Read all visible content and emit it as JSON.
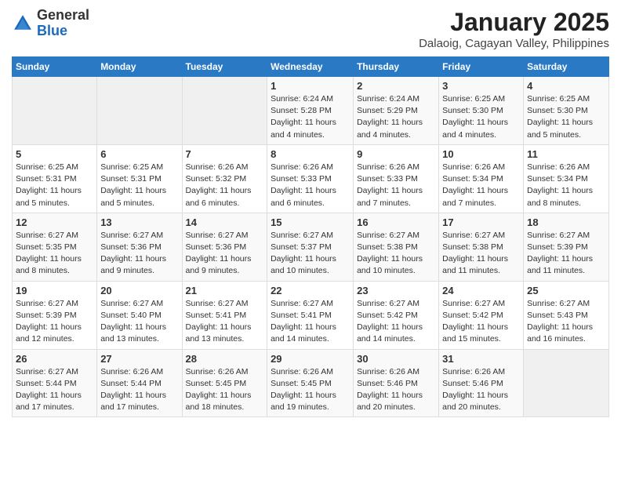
{
  "logo": {
    "general": "General",
    "blue": "Blue"
  },
  "title": "January 2025",
  "subtitle": "Dalaoig, Cagayan Valley, Philippines",
  "weekdays": [
    "Sunday",
    "Monday",
    "Tuesday",
    "Wednesday",
    "Thursday",
    "Friday",
    "Saturday"
  ],
  "weeks": [
    [
      {
        "day": "",
        "info": ""
      },
      {
        "day": "",
        "info": ""
      },
      {
        "day": "",
        "info": ""
      },
      {
        "day": "1",
        "info": "Sunrise: 6:24 AM\nSunset: 5:28 PM\nDaylight: 11 hours and 4 minutes."
      },
      {
        "day": "2",
        "info": "Sunrise: 6:24 AM\nSunset: 5:29 PM\nDaylight: 11 hours and 4 minutes."
      },
      {
        "day": "3",
        "info": "Sunrise: 6:25 AM\nSunset: 5:30 PM\nDaylight: 11 hours and 4 minutes."
      },
      {
        "day": "4",
        "info": "Sunrise: 6:25 AM\nSunset: 5:30 PM\nDaylight: 11 hours and 5 minutes."
      }
    ],
    [
      {
        "day": "5",
        "info": "Sunrise: 6:25 AM\nSunset: 5:31 PM\nDaylight: 11 hours and 5 minutes."
      },
      {
        "day": "6",
        "info": "Sunrise: 6:25 AM\nSunset: 5:31 PM\nDaylight: 11 hours and 5 minutes."
      },
      {
        "day": "7",
        "info": "Sunrise: 6:26 AM\nSunset: 5:32 PM\nDaylight: 11 hours and 6 minutes."
      },
      {
        "day": "8",
        "info": "Sunrise: 6:26 AM\nSunset: 5:33 PM\nDaylight: 11 hours and 6 minutes."
      },
      {
        "day": "9",
        "info": "Sunrise: 6:26 AM\nSunset: 5:33 PM\nDaylight: 11 hours and 7 minutes."
      },
      {
        "day": "10",
        "info": "Sunrise: 6:26 AM\nSunset: 5:34 PM\nDaylight: 11 hours and 7 minutes."
      },
      {
        "day": "11",
        "info": "Sunrise: 6:26 AM\nSunset: 5:34 PM\nDaylight: 11 hours and 8 minutes."
      }
    ],
    [
      {
        "day": "12",
        "info": "Sunrise: 6:27 AM\nSunset: 5:35 PM\nDaylight: 11 hours and 8 minutes."
      },
      {
        "day": "13",
        "info": "Sunrise: 6:27 AM\nSunset: 5:36 PM\nDaylight: 11 hours and 9 minutes."
      },
      {
        "day": "14",
        "info": "Sunrise: 6:27 AM\nSunset: 5:36 PM\nDaylight: 11 hours and 9 minutes."
      },
      {
        "day": "15",
        "info": "Sunrise: 6:27 AM\nSunset: 5:37 PM\nDaylight: 11 hours and 10 minutes."
      },
      {
        "day": "16",
        "info": "Sunrise: 6:27 AM\nSunset: 5:38 PM\nDaylight: 11 hours and 10 minutes."
      },
      {
        "day": "17",
        "info": "Sunrise: 6:27 AM\nSunset: 5:38 PM\nDaylight: 11 hours and 11 minutes."
      },
      {
        "day": "18",
        "info": "Sunrise: 6:27 AM\nSunset: 5:39 PM\nDaylight: 11 hours and 11 minutes."
      }
    ],
    [
      {
        "day": "19",
        "info": "Sunrise: 6:27 AM\nSunset: 5:39 PM\nDaylight: 11 hours and 12 minutes."
      },
      {
        "day": "20",
        "info": "Sunrise: 6:27 AM\nSunset: 5:40 PM\nDaylight: 11 hours and 13 minutes."
      },
      {
        "day": "21",
        "info": "Sunrise: 6:27 AM\nSunset: 5:41 PM\nDaylight: 11 hours and 13 minutes."
      },
      {
        "day": "22",
        "info": "Sunrise: 6:27 AM\nSunset: 5:41 PM\nDaylight: 11 hours and 14 minutes."
      },
      {
        "day": "23",
        "info": "Sunrise: 6:27 AM\nSunset: 5:42 PM\nDaylight: 11 hours and 14 minutes."
      },
      {
        "day": "24",
        "info": "Sunrise: 6:27 AM\nSunset: 5:42 PM\nDaylight: 11 hours and 15 minutes."
      },
      {
        "day": "25",
        "info": "Sunrise: 6:27 AM\nSunset: 5:43 PM\nDaylight: 11 hours and 16 minutes."
      }
    ],
    [
      {
        "day": "26",
        "info": "Sunrise: 6:27 AM\nSunset: 5:44 PM\nDaylight: 11 hours and 17 minutes."
      },
      {
        "day": "27",
        "info": "Sunrise: 6:26 AM\nSunset: 5:44 PM\nDaylight: 11 hours and 17 minutes."
      },
      {
        "day": "28",
        "info": "Sunrise: 6:26 AM\nSunset: 5:45 PM\nDaylight: 11 hours and 18 minutes."
      },
      {
        "day": "29",
        "info": "Sunrise: 6:26 AM\nSunset: 5:45 PM\nDaylight: 11 hours and 19 minutes."
      },
      {
        "day": "30",
        "info": "Sunrise: 6:26 AM\nSunset: 5:46 PM\nDaylight: 11 hours and 20 minutes."
      },
      {
        "day": "31",
        "info": "Sunrise: 6:26 AM\nSunset: 5:46 PM\nDaylight: 11 hours and 20 minutes."
      },
      {
        "day": "",
        "info": ""
      }
    ]
  ]
}
